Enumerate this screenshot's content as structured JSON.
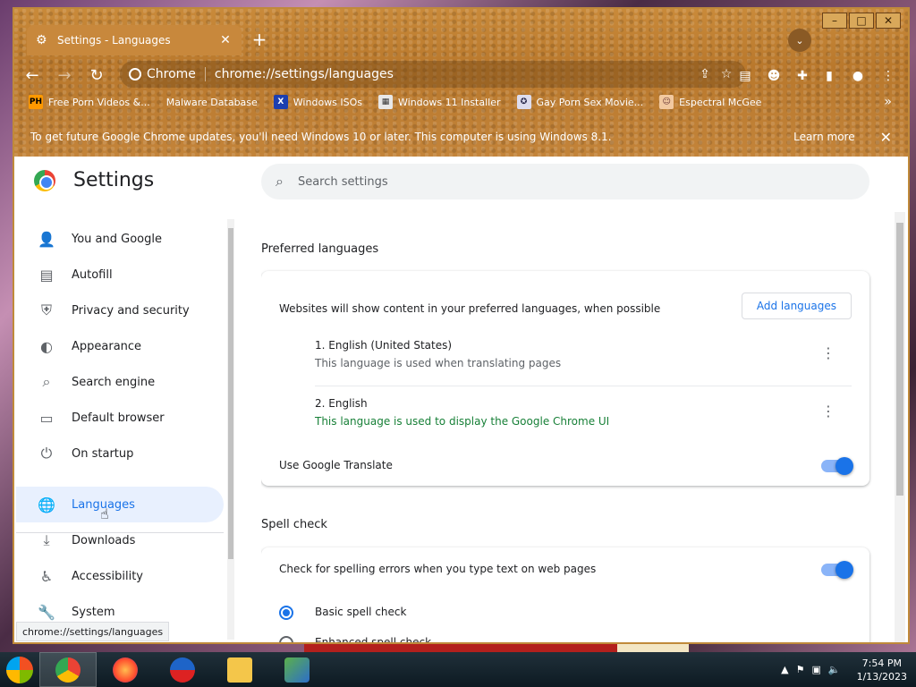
{
  "browser": {
    "tab_title": "Settings - Languages",
    "omnibox_site": "Chrome",
    "omnibox_url": "chrome://settings/languages",
    "bookmarks": [
      {
        "label": "Free Porn Videos &...",
        "icon": "PH"
      },
      {
        "label": "Malware Database",
        "icon": ""
      },
      {
        "label": "Windows ISOs",
        "icon": "X"
      },
      {
        "label": "Windows 11 Installer",
        "icon": ""
      },
      {
        "label": "Gay Porn Sex Movie...",
        "icon": ""
      },
      {
        "label": "Espectral McGee",
        "icon": ""
      }
    ],
    "infobar_message": "To get future Google Chrome updates, you'll need Windows 10 or later. This computer is using Windows 8.1.",
    "infobar_link": "Learn more",
    "status_url": "chrome://settings/languages"
  },
  "settings": {
    "title": "Settings",
    "search_placeholder": "Search settings",
    "sidebar": [
      {
        "label": "You and Google",
        "icon": "person-icon"
      },
      {
        "label": "Autofill",
        "icon": "clipboard-icon"
      },
      {
        "label": "Privacy and security",
        "icon": "shield-icon"
      },
      {
        "label": "Appearance",
        "icon": "palette-icon"
      },
      {
        "label": "Search engine",
        "icon": "search-icon"
      },
      {
        "label": "Default browser",
        "icon": "browser-icon"
      },
      {
        "label": "On startup",
        "icon": "power-icon"
      },
      {
        "label": "Languages",
        "icon": "globe-icon"
      },
      {
        "label": "Downloads",
        "icon": "download-icon"
      },
      {
        "label": "Accessibility",
        "icon": "accessibility-icon"
      },
      {
        "label": "System",
        "icon": "wrench-icon"
      }
    ],
    "preferred": {
      "section_title": "Preferred languages",
      "description": "Websites will show content in your preferred languages, when possible",
      "add_button": "Add languages",
      "languages": [
        {
          "name": "1. English (United States)",
          "sub": "This language is used when translating pages"
        },
        {
          "name": "2. English",
          "sub": "This language is used to display the Google Chrome UI"
        }
      ],
      "translate_label": "Use Google Translate"
    },
    "spell": {
      "section_title": "Spell check",
      "check_label": "Check for spelling errors when you type text on web pages",
      "basic": "Basic spell check",
      "enhanced": "Enhanced spell check"
    }
  },
  "taskbar": {
    "time": "7:54 PM",
    "date": "1/13/2023"
  }
}
